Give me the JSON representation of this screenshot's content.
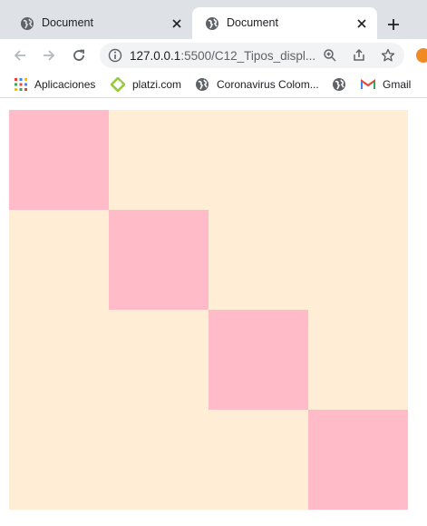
{
  "tabs": [
    {
      "title": "Document",
      "active": false
    },
    {
      "title": "Document",
      "active": true
    }
  ],
  "toolbar": {
    "url_host": "127.0.0.1",
    "url_path": ":5500/C12_Tipos_displ..."
  },
  "bookmarks": [
    {
      "label": "Aplicaciones",
      "icon": "apps-grid-icon"
    },
    {
      "label": "platzi.com",
      "icon": "platzi-icon"
    },
    {
      "label": "Coronavirus Colom...",
      "icon": "globe-icon"
    },
    {
      "label": "",
      "icon": "globe-icon"
    },
    {
      "label": "Gmail",
      "icon": "gmail-icon"
    }
  ],
  "page": {
    "container_color": "#ffeed5",
    "box_color": "#ffbbc8",
    "grid": "4x4 diagonal"
  }
}
